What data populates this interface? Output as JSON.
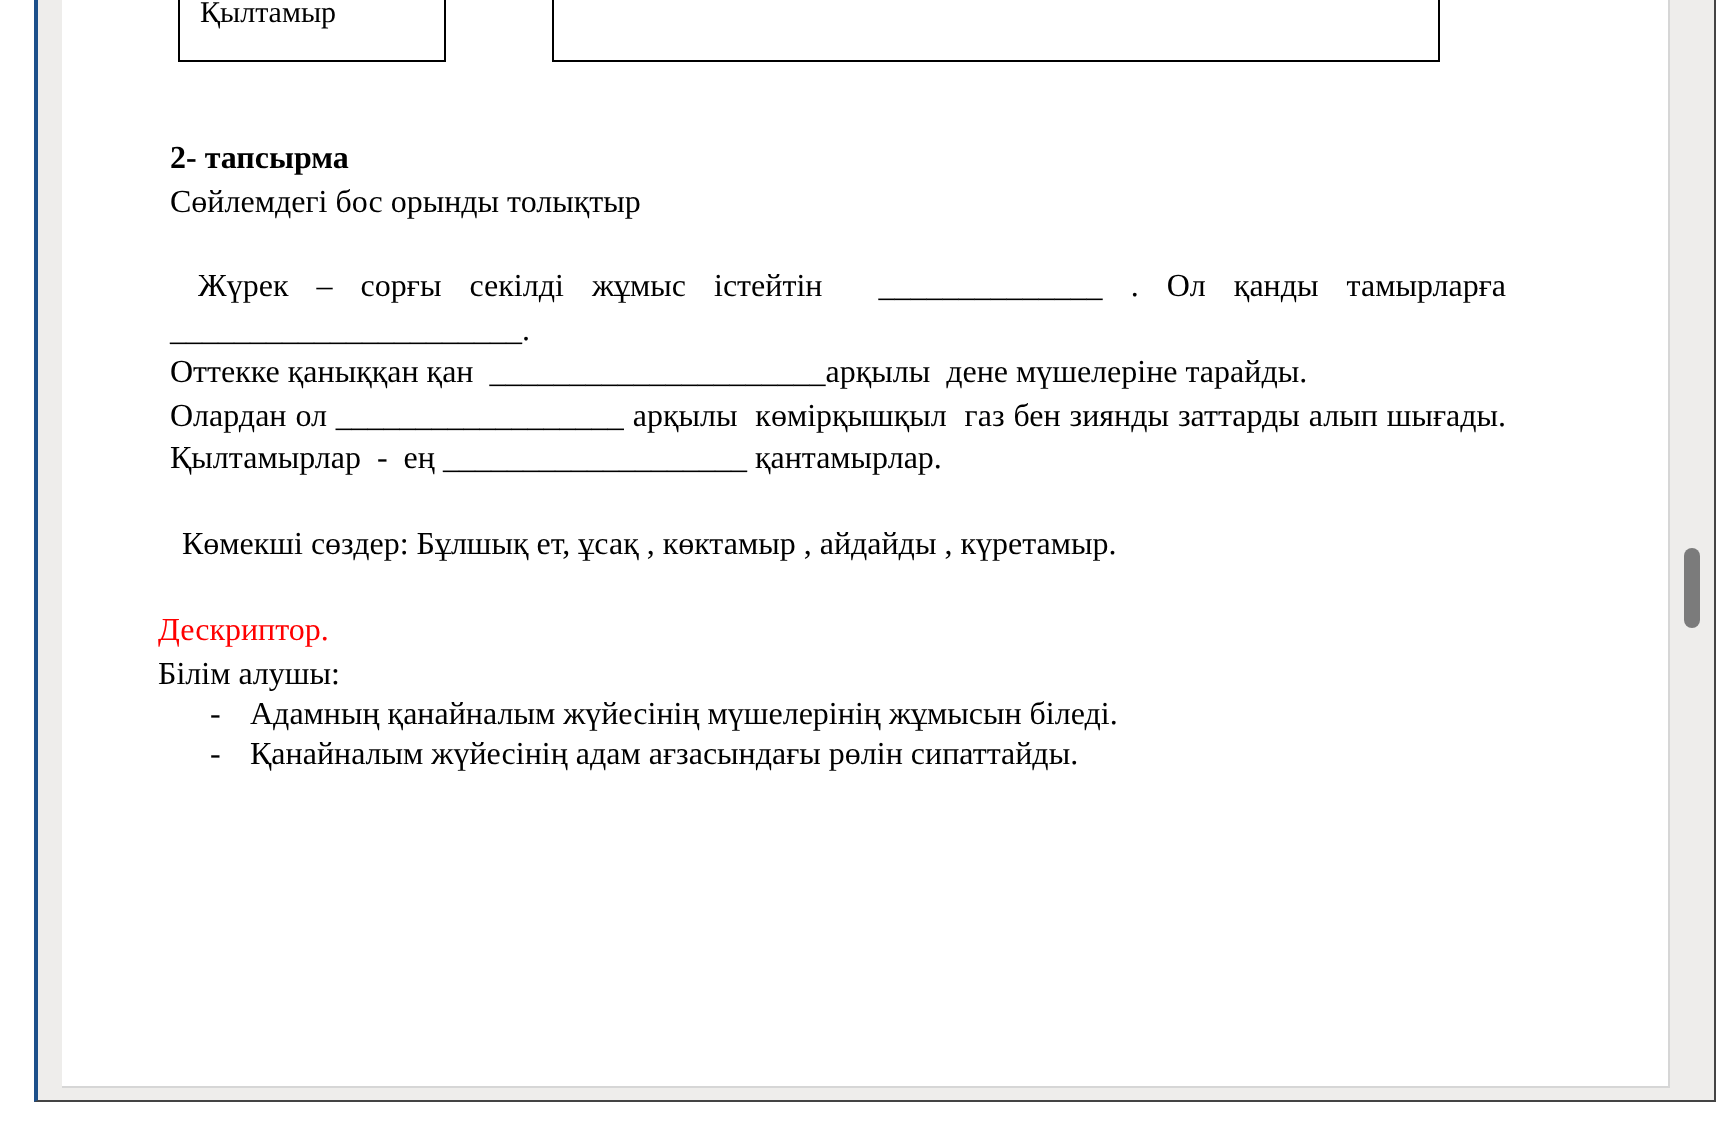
{
  "table": {
    "cells": [
      "Қылтамыр"
    ]
  },
  "task": {
    "heading": "2- тапсырма",
    "instruction": "Сөйлемдегі бос орынды толықтыр",
    "paragraphs": [
      {
        "text": "Жүрек – сорғы секілді жұмыс істейтін  ______________ . Ол қанды тамырларға ______________________.",
        "indent": true
      },
      {
        "text": "Оттекке қаныққан қан  _____________________арқылы  дене мүшелеріне тарайды.",
        "indent": false
      },
      {
        "text": "Олардан ол __________________ арқылы  көмірқышқыл  газ бен зиянды заттарды алып шығады. Қылтамырлар  -  ең ___________________ қантамырлар.",
        "indent": false
      }
    ],
    "help_words": "Көмекші сөздер: Бұлшық ет, ұсақ , көктамыр , айдайды , күретамыр."
  },
  "descriptor": {
    "title": "Дескриптор.",
    "subtitle": "Білім алушы:",
    "items": [
      {
        "marker": "-",
        "text": "Адамның қанайналым жүйесінің  мүшелерінің  жұмысын біледі."
      },
      {
        "marker": "-",
        "text": "Қанайналым жүйесінің адам ағзасындағы рөлін сипаттайды."
      }
    ]
  }
}
